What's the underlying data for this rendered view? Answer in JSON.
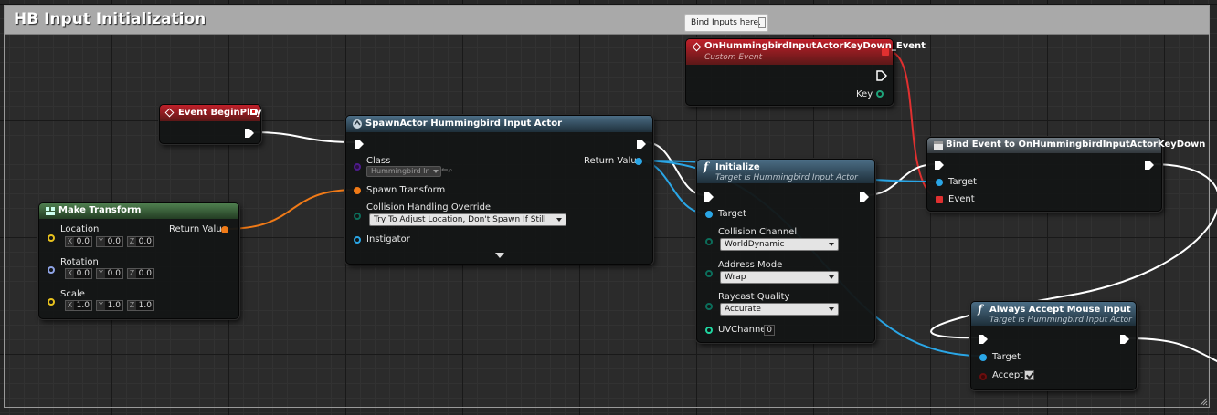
{
  "comment": {
    "title": "HB Input Initialization"
  },
  "tooltip": {
    "text": "Bind Inputs here."
  },
  "event_beginplay": {
    "title": "Event BeginPlay"
  },
  "custom_event": {
    "title": "OnHummingbirdInputActorKeyDown_Event",
    "subtitle": "Custom Event",
    "key_label": "Key"
  },
  "spawn_actor": {
    "title": "SpawnActor Hummingbird Input Actor",
    "class_label": "Class",
    "class_value": "Hummingbird In",
    "return_label": "Return Value",
    "spawn_transform_label": "Spawn Transform",
    "collision_label": "Collision Handling Override",
    "collision_value": "Try To Adjust Location, Don't Spawn If Still Colliding",
    "instigator_label": "Instigator"
  },
  "make_transform": {
    "title": "Make Transform",
    "return_label": "Return Value",
    "location_label": "Location",
    "location": [
      "X",
      "0.0",
      "Y",
      "0.0",
      "Z",
      "0.0"
    ],
    "rotation_label": "Rotation",
    "rotation": [
      "X",
      "0.0",
      "Y",
      "0.0",
      "Z",
      "0.0"
    ],
    "scale_label": "Scale",
    "scale": [
      "X",
      "1.0",
      "Y",
      "1.0",
      "Z",
      "1.0"
    ]
  },
  "initialize": {
    "title": "Initialize",
    "subtitle": "Target is Hummingbird Input Actor",
    "target_label": "Target",
    "collision_channel_label": "Collision Channel",
    "collision_channel_value": "WorldDynamic",
    "address_mode_label": "Address Mode",
    "address_mode_value": "Wrap",
    "raycast_quality_label": "Raycast Quality",
    "raycast_quality_value": "Accurate",
    "uv_channel_label": "UVChannel",
    "uv_channel_value": "0"
  },
  "bind_event": {
    "title": "Bind Event to OnHummingbirdInputActorKeyDown",
    "target_label": "Target",
    "event_label": "Event"
  },
  "accept_mouse": {
    "title": "Always Accept Mouse Input",
    "subtitle": "Target is Hummingbird Input Actor",
    "target_label": "Target",
    "accept_label": "Accept",
    "accept_checked": true
  },
  "colors": {
    "exec_wire": "#ffffff",
    "object_wire": "#2aa6e6",
    "struct_wire": "#f07a17",
    "delegate_wire": "#e03030",
    "event_header": "#c0202a",
    "function_header": "#4b6d85"
  },
  "icons": [
    "event-diamond-icon",
    "function-icon",
    "spawn-icon",
    "struct-icon",
    "bind-event-icon",
    "checkbox-icon",
    "dropdown-arrow-icon",
    "resize-grip-icon"
  ]
}
